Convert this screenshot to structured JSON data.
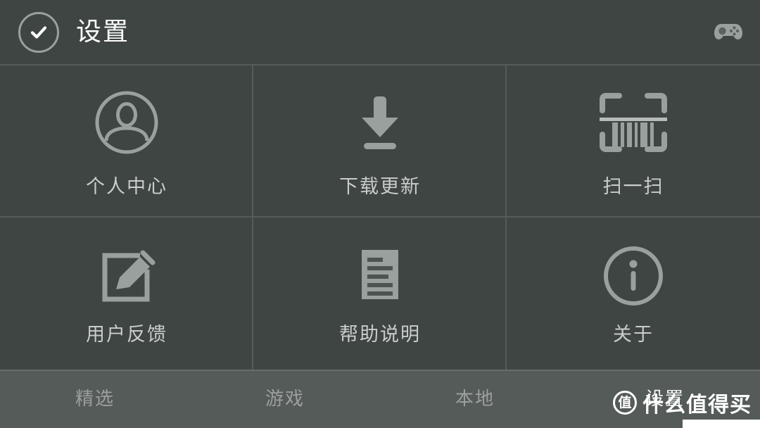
{
  "header": {
    "title": "设置",
    "back_icon": "check-circle-icon",
    "right_icon": "gamepad-icon"
  },
  "colors": {
    "background": "#3e4543",
    "divider": "#565c5a",
    "bottom_bar": "#555b59",
    "label": "#c9cdcc",
    "title": "#ffffff",
    "nav_inactive": "#9ba09e",
    "nav_active": "#f2f4f3",
    "icon": "#9aa09e"
  },
  "grid": {
    "items": [
      {
        "label": "个人中心",
        "icon": "user-circle-icon"
      },
      {
        "label": "下载更新",
        "icon": "download-icon"
      },
      {
        "label": "扫一扫",
        "icon": "barcode-scan-icon"
      },
      {
        "label": "用户反馈",
        "icon": "edit-pencil-square-icon"
      },
      {
        "label": "帮助说明",
        "icon": "document-lines-icon"
      },
      {
        "label": "关于",
        "icon": "info-circle-icon"
      }
    ]
  },
  "bottom_nav": {
    "items": [
      {
        "label": "精选",
        "active": false
      },
      {
        "label": "游戏",
        "active": false
      },
      {
        "label": "本地",
        "active": false
      },
      {
        "label": "设置",
        "active": true
      }
    ]
  },
  "watermark": {
    "logo_text": "值",
    "text": "什么值得买"
  }
}
